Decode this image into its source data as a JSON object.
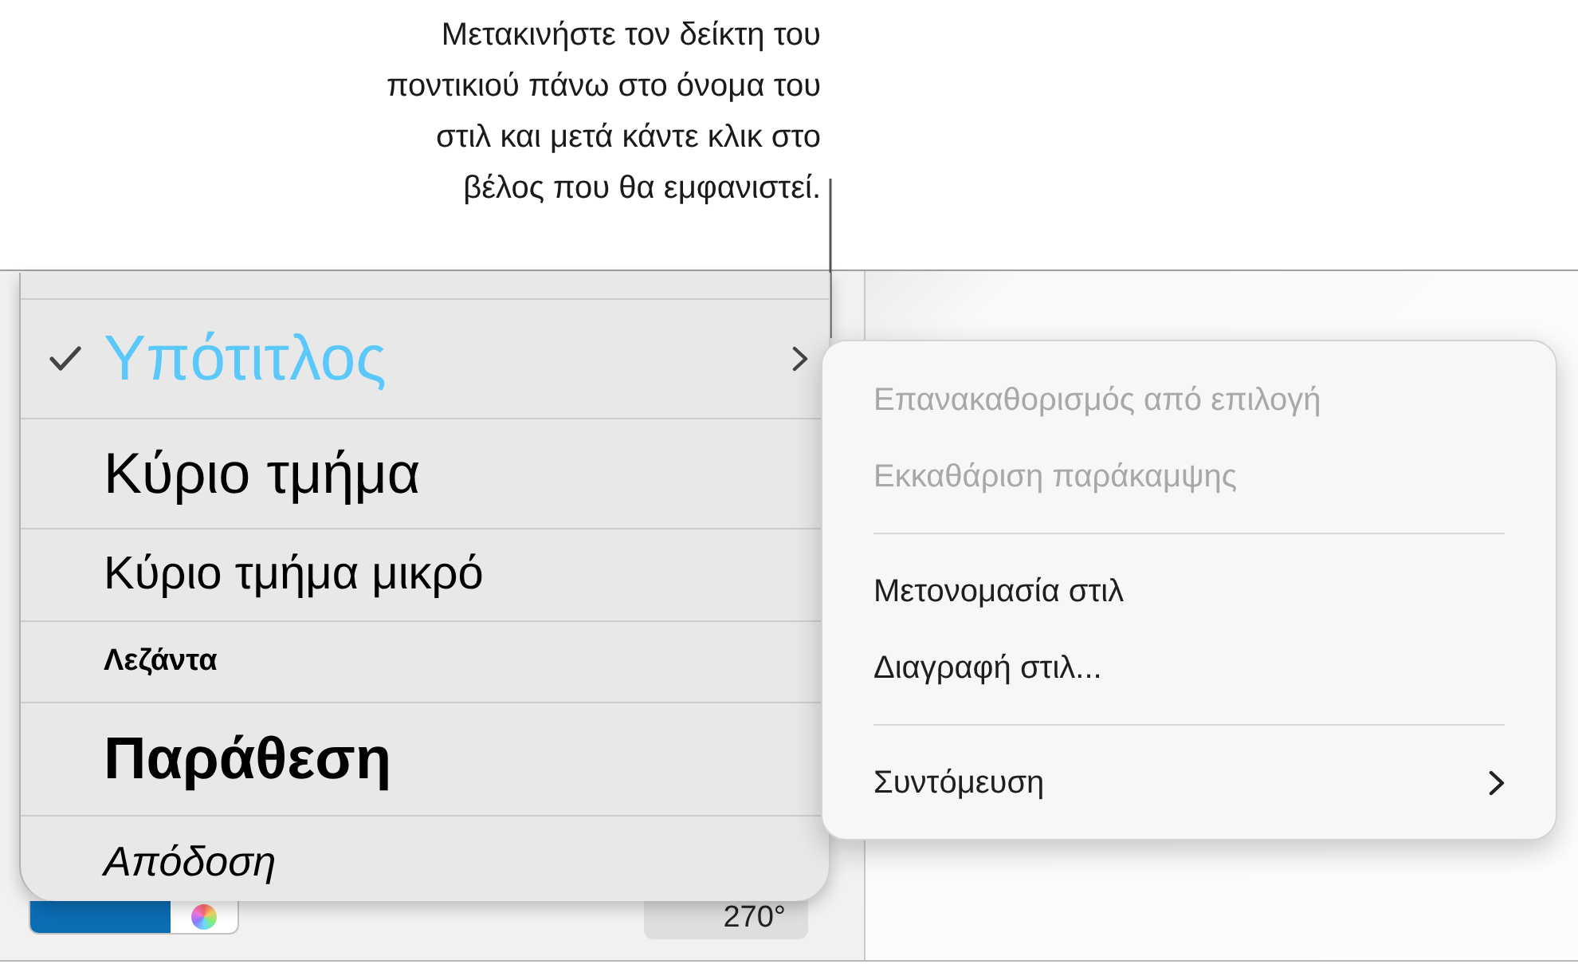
{
  "callout": {
    "text": "Μετακινήστε τον δείκτη του\nποντικιού πάνω στο όνομα του\nστιλ και μετά κάντε κλικ στο\nβέλος που θα εμφανιστεί."
  },
  "styles": [
    {
      "label": "Υπότιτλος",
      "kind": "subtitle",
      "selected": true,
      "expanded": true,
      "color": "#5ac8fa"
    },
    {
      "label": "Κύριο τμήμα",
      "kind": "body",
      "selected": false,
      "expanded": false,
      "color": "#000000"
    },
    {
      "label": "Κύριο τμήμα μικρό",
      "kind": "body-small",
      "selected": false,
      "expanded": false,
      "color": "#000000"
    },
    {
      "label": "Λεζάντα",
      "kind": "caption",
      "selected": false,
      "expanded": false,
      "color": "#000000"
    },
    {
      "label": "Παράθεση",
      "kind": "quote",
      "selected": false,
      "expanded": false,
      "color": "#000000"
    },
    {
      "label": "Απόδοση",
      "kind": "attribution",
      "selected": false,
      "expanded": false,
      "color": "#000000"
    }
  ],
  "context_menu": {
    "groups": [
      {
        "items": [
          {
            "label": "Επανακαθορισμός από επιλογή",
            "disabled": true,
            "submenu": false
          },
          {
            "label": "Εκκαθάριση παράκαμψης",
            "disabled": true,
            "submenu": false
          }
        ]
      },
      {
        "items": [
          {
            "label": "Μετονομασία στιλ",
            "disabled": false,
            "submenu": false
          },
          {
            "label": "Διαγραφή στιλ...",
            "disabled": false,
            "submenu": false
          }
        ]
      },
      {
        "items": [
          {
            "label": "Συντόμευση",
            "disabled": false,
            "submenu": true
          }
        ]
      }
    ]
  },
  "color_well": {
    "color": "#0b6db3"
  },
  "angle_field": {
    "value": "270°"
  }
}
